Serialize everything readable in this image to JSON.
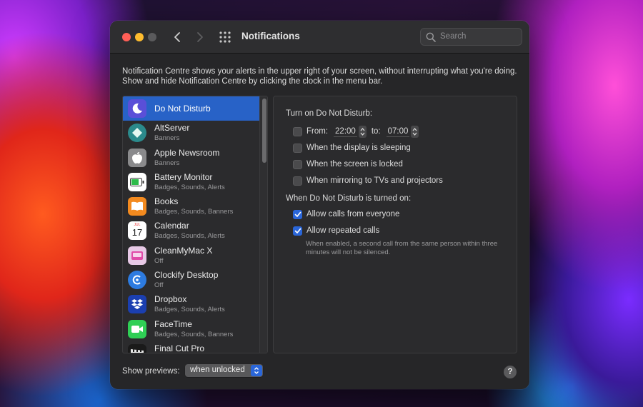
{
  "window": {
    "title": "Notifications",
    "search_placeholder": "Search"
  },
  "description": "Notification Centre shows your alerts in the upper right of your screen, without interrupting what you're doing. Show and hide Notification Centre by clicking the clock in the menu bar.",
  "apps": [
    {
      "name": "Do Not Disturb",
      "subtitle": "",
      "icon": "moon-icon"
    },
    {
      "name": "AltServer",
      "subtitle": "Banners",
      "icon": "altserver-icon"
    },
    {
      "name": "Apple Newsroom",
      "subtitle": "Banners",
      "icon": "apple-icon"
    },
    {
      "name": "Battery Monitor",
      "subtitle": "Badges, Sounds, Alerts",
      "icon": "battery-icon"
    },
    {
      "name": "Books",
      "subtitle": "Badges, Sounds, Banners",
      "icon": "books-icon"
    },
    {
      "name": "Calendar",
      "subtitle": "Badges, Sounds, Alerts",
      "icon": "calendar-icon",
      "icon_month": "JUL",
      "icon_day": "17"
    },
    {
      "name": "CleanMyMac X",
      "subtitle": "Off",
      "icon": "cleanmymac-icon"
    },
    {
      "name": "Clockify Desktop",
      "subtitle": "Off",
      "icon": "clockify-icon"
    },
    {
      "name": "Dropbox",
      "subtitle": "Badges, Sounds, Alerts",
      "icon": "dropbox-icon"
    },
    {
      "name": "FaceTime",
      "subtitle": "Badges, Sounds, Banners",
      "icon": "facetime-icon"
    },
    {
      "name": "Final Cut Pro",
      "subtitle": "",
      "icon": "final-cut-pro-icon"
    }
  ],
  "dnd": {
    "heading": "Turn on Do Not Disturb:",
    "from_label": "From:",
    "from_time": "22:00",
    "to_label": "to:",
    "to_time": "07:00",
    "from_checked": false,
    "options": [
      {
        "label": "When the display is sleeping",
        "checked": false
      },
      {
        "label": "When the screen is locked",
        "checked": false
      },
      {
        "label": "When mirroring to TVs and projectors",
        "checked": false
      }
    ],
    "on_heading": "When Do Not Disturb is turned on:",
    "on_options": [
      {
        "label": "Allow calls from everyone",
        "checked": true
      },
      {
        "label": "Allow repeated calls",
        "checked": true
      }
    ],
    "help_text": "When enabled, a second call from the same person within three minutes will not be silenced."
  },
  "footer": {
    "preview_label": "Show previews:",
    "preview_value": "when unlocked",
    "help_label": "?"
  },
  "colors": {
    "accent": "#2a66d9",
    "selection": "#2862c7",
    "close": "#ff5f57",
    "minimize": "#febc2e"
  }
}
